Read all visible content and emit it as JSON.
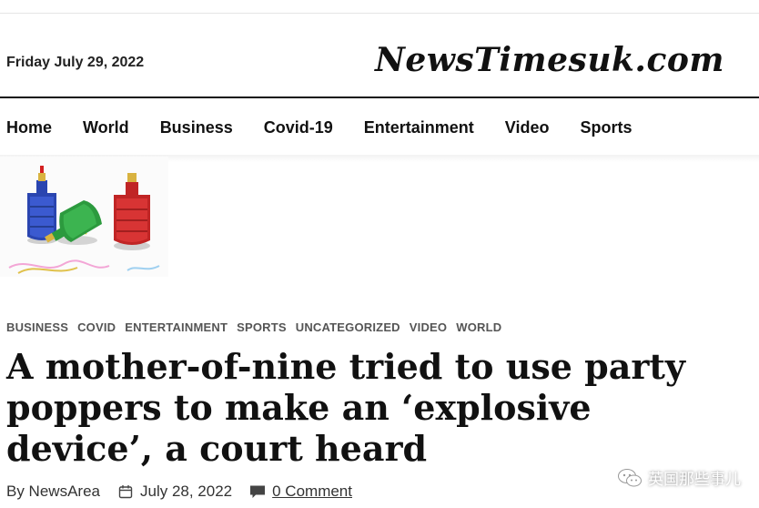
{
  "header": {
    "date": "Friday July 29, 2022",
    "logo": "NewsTimesuk.com"
  },
  "nav": {
    "items": [
      "Home",
      "World",
      "Business",
      "Covid-19",
      "Entertainment",
      "Video",
      "Sports"
    ]
  },
  "article": {
    "categories": [
      "BUSINESS",
      "COVID",
      "ENTERTAINMENT",
      "SPORTS",
      "UNCATEGORIZED",
      "VIDEO",
      "WORLD"
    ],
    "headline": "A mother-of-nine tried to use party poppers to make an ‘explosive device’, a court heard",
    "author": "By NewsArea",
    "date": "July 28, 2022",
    "comments": "0 Comment",
    "thumbnail_icon": "party-poppers-image"
  },
  "watermark": {
    "text": "英国那些事儿",
    "icon": "wechat-icon"
  }
}
